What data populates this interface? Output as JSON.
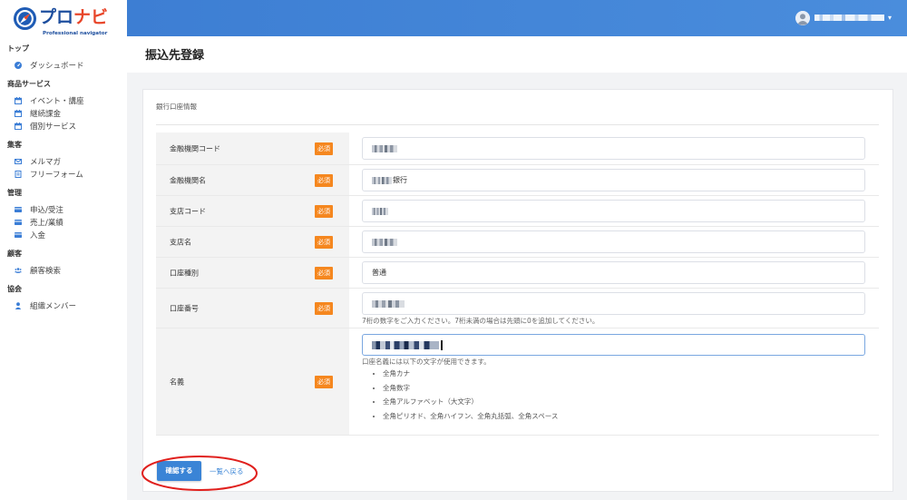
{
  "app": {
    "logo_part1": "プロ",
    "logo_part2": "ナビ",
    "logo_tagline": "Professional navigator"
  },
  "header": {
    "username_masked": true,
    "user_menu_icon": "avatar-icon"
  },
  "sidebar": {
    "sections": [
      {
        "title": "トップ",
        "items": [
          {
            "label": "ダッシュボード",
            "icon": "dashboard-icon"
          }
        ]
      },
      {
        "title": "商品サービス",
        "items": [
          {
            "label": "イベント・講座",
            "icon": "calendar-icon"
          },
          {
            "label": "継続課金",
            "icon": "calendar-icon"
          },
          {
            "label": "個別サービス",
            "icon": "calendar-icon"
          }
        ]
      },
      {
        "title": "集客",
        "items": [
          {
            "label": "メルマガ",
            "icon": "envelope-icon"
          },
          {
            "label": "フリーフォーム",
            "icon": "file-icon"
          }
        ]
      },
      {
        "title": "管理",
        "items": [
          {
            "label": "申込/受注",
            "icon": "credit-card-icon"
          },
          {
            "label": "売上/業績",
            "icon": "credit-card-icon"
          },
          {
            "label": "入金",
            "icon": "credit-card-icon"
          }
        ]
      },
      {
        "title": "顧客",
        "items": [
          {
            "label": "顧客検索",
            "icon": "users-icon"
          }
        ]
      },
      {
        "title": "協会",
        "items": [
          {
            "label": "組織メンバー",
            "icon": "user-icon"
          }
        ]
      }
    ]
  },
  "page": {
    "title": "振込先登録"
  },
  "form": {
    "section_title": "銀行口座情報",
    "required_badge": "必須",
    "fields": [
      {
        "label": "金融機関コード",
        "value": "",
        "masked": true
      },
      {
        "label": "金融機関名",
        "value": "銀行",
        "masked": true
      },
      {
        "label": "支店コード",
        "value": "",
        "masked": true
      },
      {
        "label": "支店名",
        "value": "",
        "masked": true
      },
      {
        "label": "口座種別",
        "value": "普通",
        "masked": false
      },
      {
        "label": "口座番号",
        "value": "",
        "masked": true,
        "help": "7桁の数字をご入力ください。7桁未満の場合は先頭に0を追加してください。"
      },
      {
        "label": "名義",
        "value": "",
        "masked": true,
        "focused": true,
        "help": "口座名義には以下の文字が使用できます。",
        "allowed_chars": [
          "全角カナ",
          "全角数字",
          "全角アルファベット（大文字）",
          "全角ピリオド、全角ハイフン、全角丸括弧、全角スペース"
        ]
      }
    ]
  },
  "actions": {
    "confirm_label": "確認する",
    "back_label": "一覧へ戻る"
  },
  "colors": {
    "header_blue": "#3d7ed3",
    "accent": "#3a84d6",
    "required_badge": "#f5871f",
    "label_column_bg": "#f3f3f3",
    "logo_blue": "#1d4e9e",
    "logo_orange": "#e8462a",
    "annotation_red": "#e0201d"
  }
}
